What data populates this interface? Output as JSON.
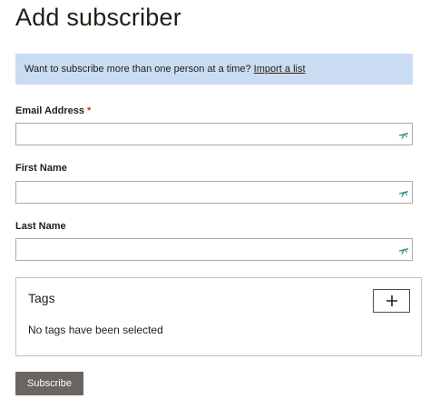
{
  "page": {
    "title": "Add subscriber"
  },
  "banner": {
    "text": "Want to subscribe more than one person at a time?",
    "link_label": "Import a list"
  },
  "fields": {
    "email": {
      "label": "Email Address",
      "required_mark": "*",
      "value": ""
    },
    "first_name": {
      "label": "First Name",
      "value": ""
    },
    "last_name": {
      "label": "Last Name",
      "value": ""
    }
  },
  "tags": {
    "title": "Tags",
    "add_label": "+",
    "empty_text": "No tags have been selected"
  },
  "actions": {
    "subscribe_label": "Subscribe"
  },
  "icons": {
    "field_autofill": "autofill-key-icon",
    "add_tag": "plus-icon"
  },
  "colors": {
    "banner_bg": "#c9dcf2",
    "required": "#d13a0b",
    "autofill_icon": "#2a8c8c",
    "subscribe_bg": "#6b645f"
  }
}
